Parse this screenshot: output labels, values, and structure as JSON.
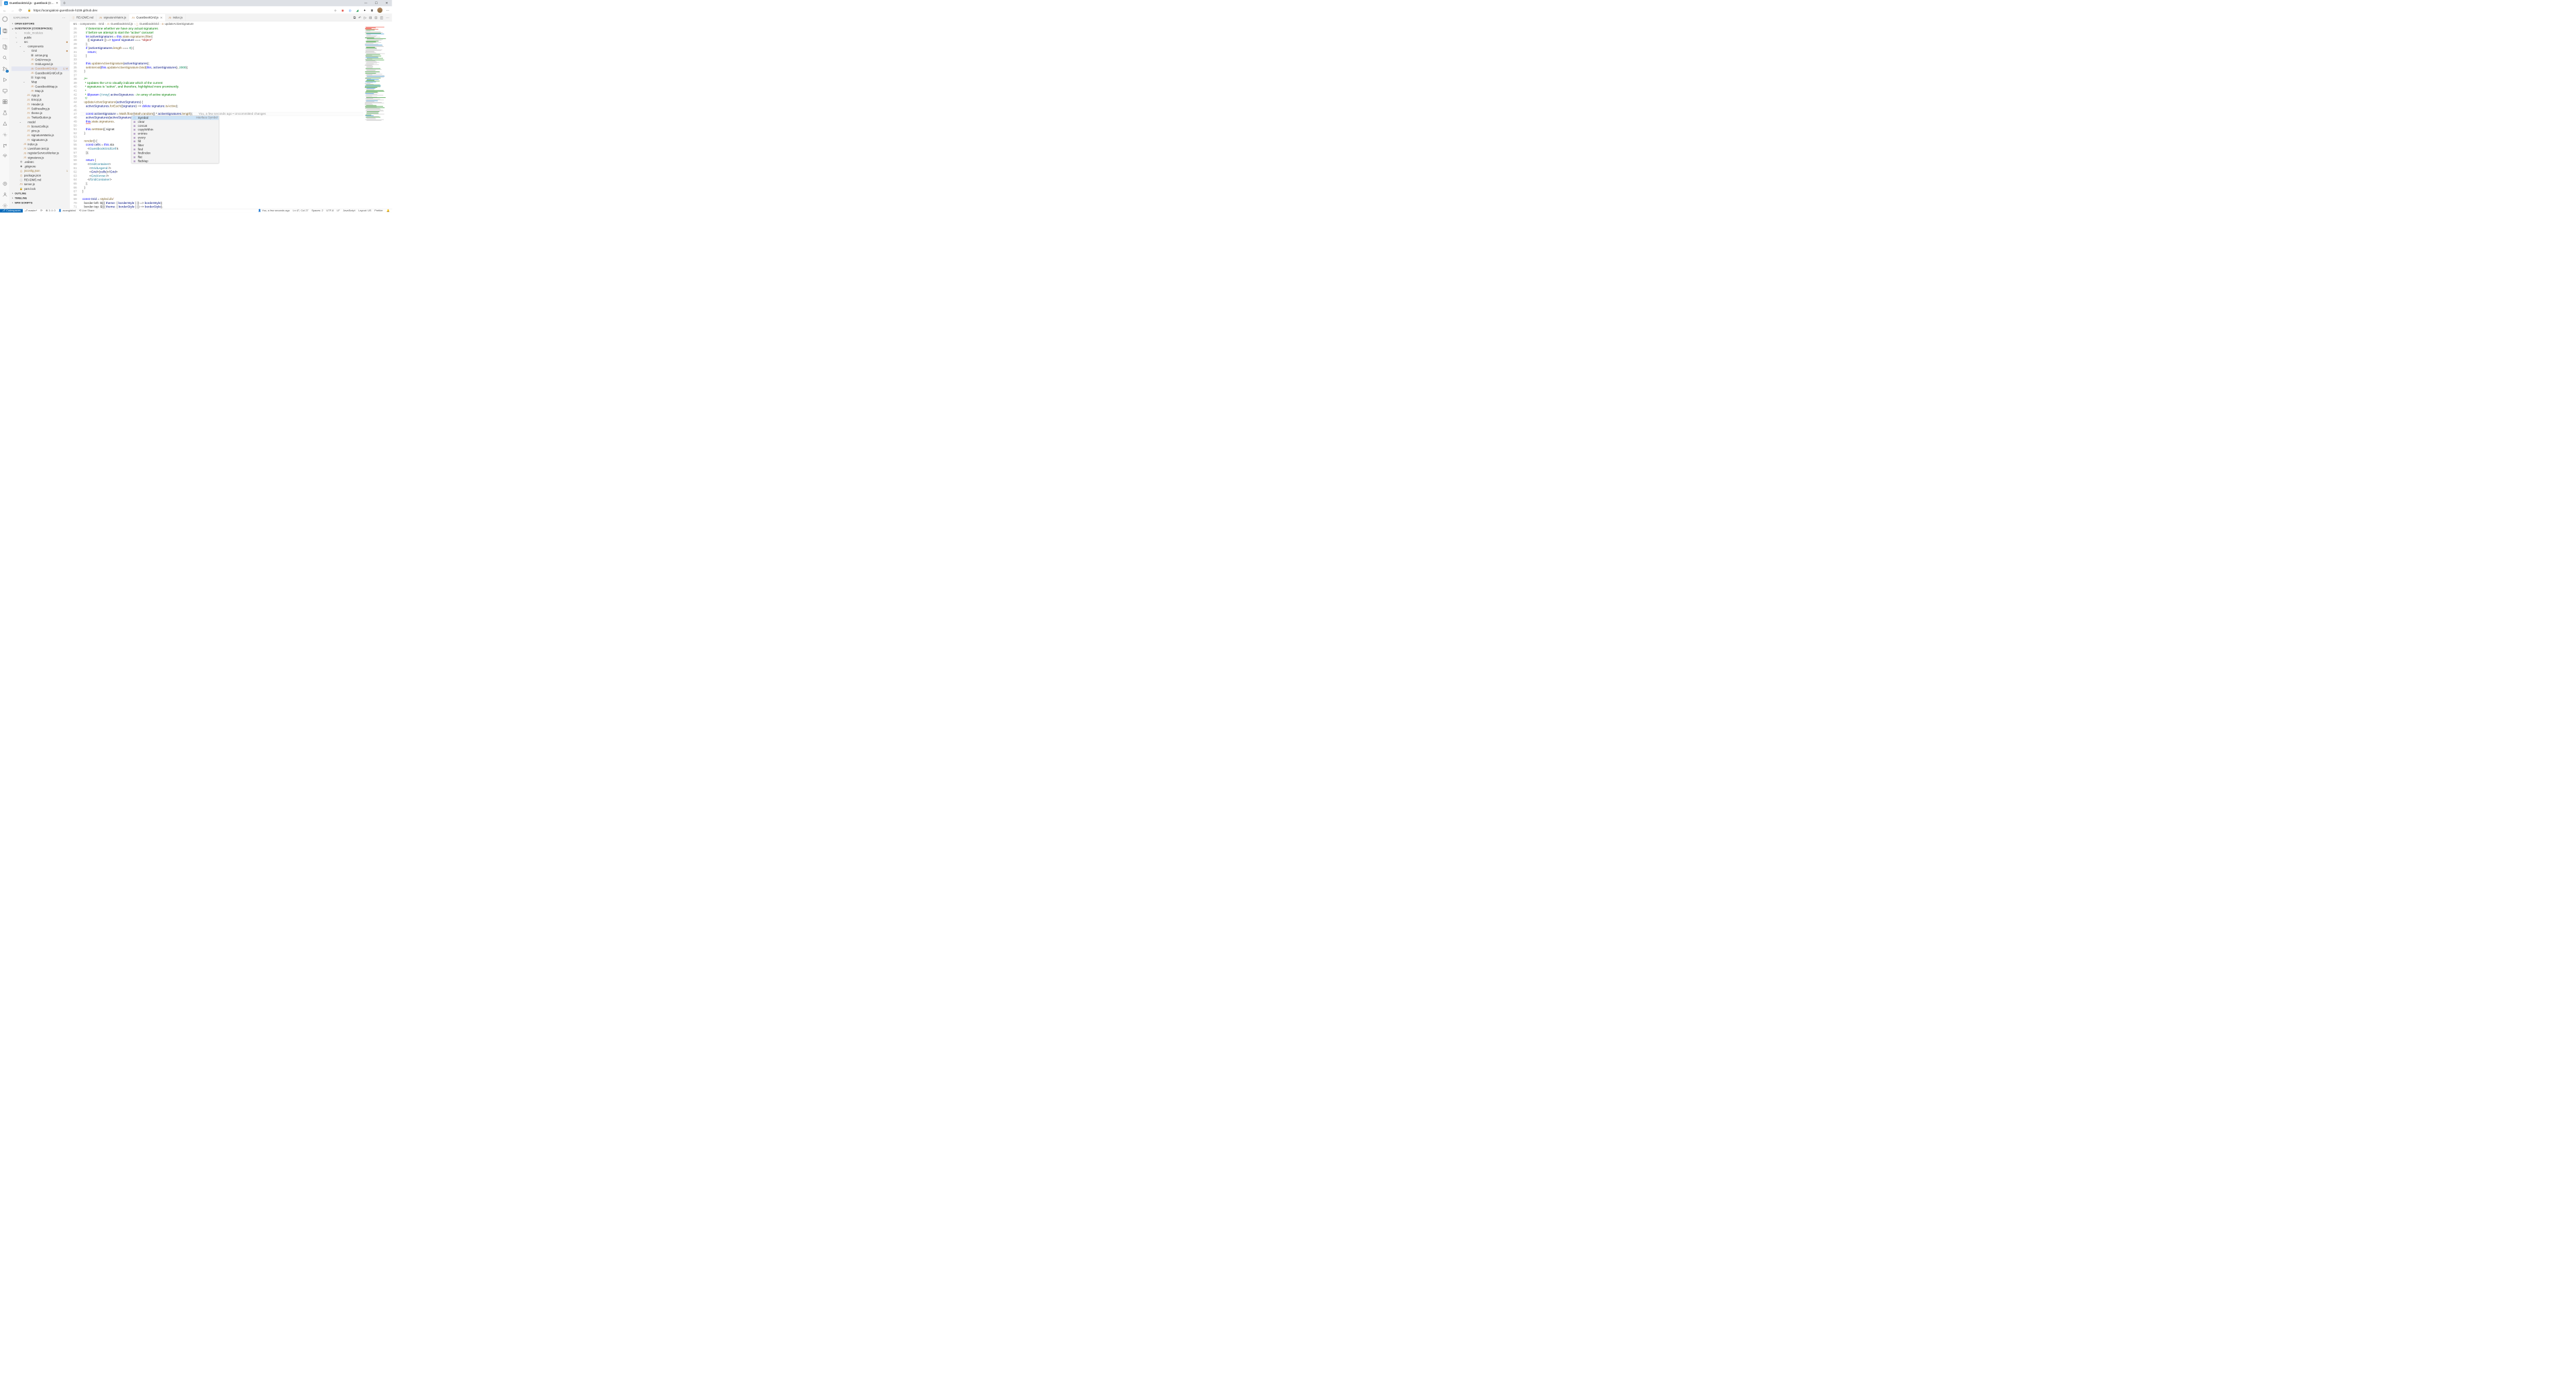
{
  "browser": {
    "tab": {
      "title": "GuestbookGrid.js - guestbook (C…"
    },
    "url": "https://acangialosi-guestbook-h239.github.dev"
  },
  "sidebar": {
    "title": "EXPLORER",
    "sections": {
      "openEditors": "OPEN EDITORS",
      "workspace": "GUESTBOOK [CODESPACES]",
      "outline": "OUTLINE",
      "timeline": "TIMELINE",
      "npm": "NPM SCRIPTS"
    },
    "tree": [
      {
        "indent": 1,
        "name": "node_modules",
        "folder": true,
        "faded": true
      },
      {
        "indent": 1,
        "name": "public",
        "folder": true,
        "chev": "›"
      },
      {
        "indent": 1,
        "name": "src",
        "folder": true,
        "chev": "⌄",
        "mod": true
      },
      {
        "indent": 2,
        "name": "components",
        "folder": true,
        "chev": "⌄"
      },
      {
        "indent": 3,
        "name": "Grid",
        "folder": true,
        "chev": "⌄",
        "mod": true
      },
      {
        "indent": 4,
        "name": "arrow.png",
        "icon": "▦"
      },
      {
        "indent": 4,
        "name": "GridArrow.js",
        "icon": "JS"
      },
      {
        "indent": 4,
        "name": "GridLegend.js",
        "icon": "JS"
      },
      {
        "indent": 4,
        "name": "GuestbookGrid.js",
        "icon": "JS",
        "selected": true,
        "status": "2, M",
        "modified": true
      },
      {
        "indent": 4,
        "name": "GuestbookGridCell.js",
        "icon": "JS"
      },
      {
        "indent": 4,
        "name": "logo.svg",
        "icon": "▧"
      },
      {
        "indent": 3,
        "name": "Map",
        "folder": true,
        "chev": "⌄"
      },
      {
        "indent": 4,
        "name": "GuestbookMap.js",
        "icon": "JS"
      },
      {
        "indent": 4,
        "name": "Map.js",
        "icon": "JS"
      },
      {
        "indent": 3,
        "name": "App.js",
        "icon": "JS"
      },
      {
        "indent": 3,
        "name": "Emoji.js",
        "icon": "JS"
      },
      {
        "indent": 3,
        "name": "Header.js",
        "icon": "JS"
      },
      {
        "indent": 3,
        "name": "Subheading.js",
        "icon": "JS"
      },
      {
        "indent": 3,
        "name": "theme.js",
        "icon": "JS"
      },
      {
        "indent": 3,
        "name": "TwitterButton.js",
        "icon": "JS"
      },
      {
        "indent": 2,
        "name": "model",
        "folder": true,
        "chev": "⌄"
      },
      {
        "indent": 3,
        "name": "bonusCells.js",
        "icon": "JS"
      },
      {
        "indent": 3,
        "name": "pins.js",
        "icon": "JS"
      },
      {
        "indent": 3,
        "name": "signatureMatrix.js",
        "icon": "JS"
      },
      {
        "indent": 3,
        "name": "signatures.js",
        "icon": "JS"
      },
      {
        "indent": 2,
        "name": "index.js",
        "icon": "JS"
      },
      {
        "indent": 2,
        "name": "LiveShare.test.js",
        "icon": "JS"
      },
      {
        "indent": 2,
        "name": "registerServiceWorker.js",
        "icon": "JS"
      },
      {
        "indent": 2,
        "name": "signatures.js",
        "icon": "JS"
      },
      {
        "indent": 1,
        "name": ".eslintrc",
        "icon": "⚙"
      },
      {
        "indent": 1,
        "name": ".gitignore",
        "icon": "◆"
      },
      {
        "indent": 1,
        "name": "jsconfig.json",
        "icon": "{}",
        "warn": true,
        "status": "1"
      },
      {
        "indent": 1,
        "name": "package.json",
        "icon": "{}"
      },
      {
        "indent": 1,
        "name": "README.md",
        "icon": "ⓘ"
      },
      {
        "indent": 1,
        "name": "server.js",
        "icon": "JS"
      },
      {
        "indent": 1,
        "name": "yarn.lock",
        "icon": "🔒"
      }
    ]
  },
  "tabs": [
    {
      "name": "README.md",
      "icon": "ⓘ",
      "active": false
    },
    {
      "name": "signatureMatrix.js",
      "icon": "JS",
      "active": false
    },
    {
      "name": "GuestbookGrid.js",
      "icon": "JS",
      "active": true,
      "dirty": true
    },
    {
      "name": "index.js",
      "icon": "JS",
      "active": false
    }
  ],
  "breadcrumb": [
    "src",
    "components",
    "Grid",
    "GuestbookGrid.js",
    "GuestbookGrid",
    "updateActiveSignature"
  ],
  "code": {
    "startLine": 25,
    "endLine": 69,
    "lines": [
      "      // Determine whether we have any actual signatures",
      "      // before we attempt to start the \"active\" carousel",
      "      let activeSignatures = this.state.signatures.filter(",
      "        ({ signature }) => typeof signature === \"object\"",
      "      );",
      "      if (activeSignatures.length === 0) {",
      "        return;",
      "      }",
      "",
      "      this.updateActiveSignature(activeSignatures);",
      "      setInterval(this.updateActiveSignature.bind(this, activeSignatures), 2000);",
      "    }",
      "",
      "    /**",
      "     * Updates the UI to visually indicate which of the current",
      "     * signatures is \"active\", and therefore, highlighted more prominently.",
      "     *",
      "     * @param {Array} activeSignatures - An array of active signatures",
      "     */",
      "    updateActiveSignature(activeSignatures) {",
      "      activeSignatures.forEach((signature) => delete signature.isActive);",
      "",
      "      const activeSignature = Math.floor(Math.random() * activeSignatures.length);",
      "      activeSignatures[activeSignature].isActive = true;",
      "      this.state.signatures.",
      "",
      "      this.setState({ signat",
      "    }",
      "",
      "    render() {",
      "      const cells = this.sta",
      "        <GuestbookGridCell k",
      "      ));",
      "",
      "      return (",
      "        <GridContainer>",
      "          <GridLegend />",
      "          <Grid>{cells}</Grid>",
      "          <GridArrow />",
      "        </GridContainer>",
      "      );",
      "    }",
      "  }",
      "",
      "  const Grid = styled.div`",
      "    border-left: ${({ theme: { borderStyle } }) => borderStyle};",
      "    border-top: ${({ theme: { borderStyle } }) => borderStyle};",
      "    display: flex;"
    ],
    "blame": "You, a few seconds ago • Uncommitted changes"
  },
  "suggest": {
    "info": "interface Symbol",
    "items": [
      {
        "icon": "⬚",
        "label": "Symbol",
        "selected": true
      },
      {
        "icon": "⊞",
        "label": "clear"
      },
      {
        "icon": "⊞",
        "label": "concat"
      },
      {
        "icon": "⊞",
        "label": "copyWithin"
      },
      {
        "icon": "⊞",
        "label": "entries"
      },
      {
        "icon": "⊞",
        "label": "every"
      },
      {
        "icon": "⊞",
        "label": "fill"
      },
      {
        "icon": "⊞",
        "label": "filter"
      },
      {
        "icon": "⊞",
        "label": "find"
      },
      {
        "icon": "⊞",
        "label": "findIndex"
      },
      {
        "icon": "⊞",
        "label": "flat"
      },
      {
        "icon": "⊞",
        "label": "flatMap"
      }
    ]
  },
  "status": {
    "codespaces": "Codespaces",
    "branch": "master*",
    "sync": "⟳",
    "errors": "3",
    "warnings": "0",
    "user": "acangialosi",
    "liveshare": "Live Share",
    "blame": "You, a few seconds ago",
    "cursor": "Ln 47, Col 27",
    "spaces": "Spaces: 2",
    "encoding": "UTF-8",
    "eol": "LF",
    "lang": "JavaScript",
    "layout": "Layout: US",
    "prettier": "Prettier"
  }
}
